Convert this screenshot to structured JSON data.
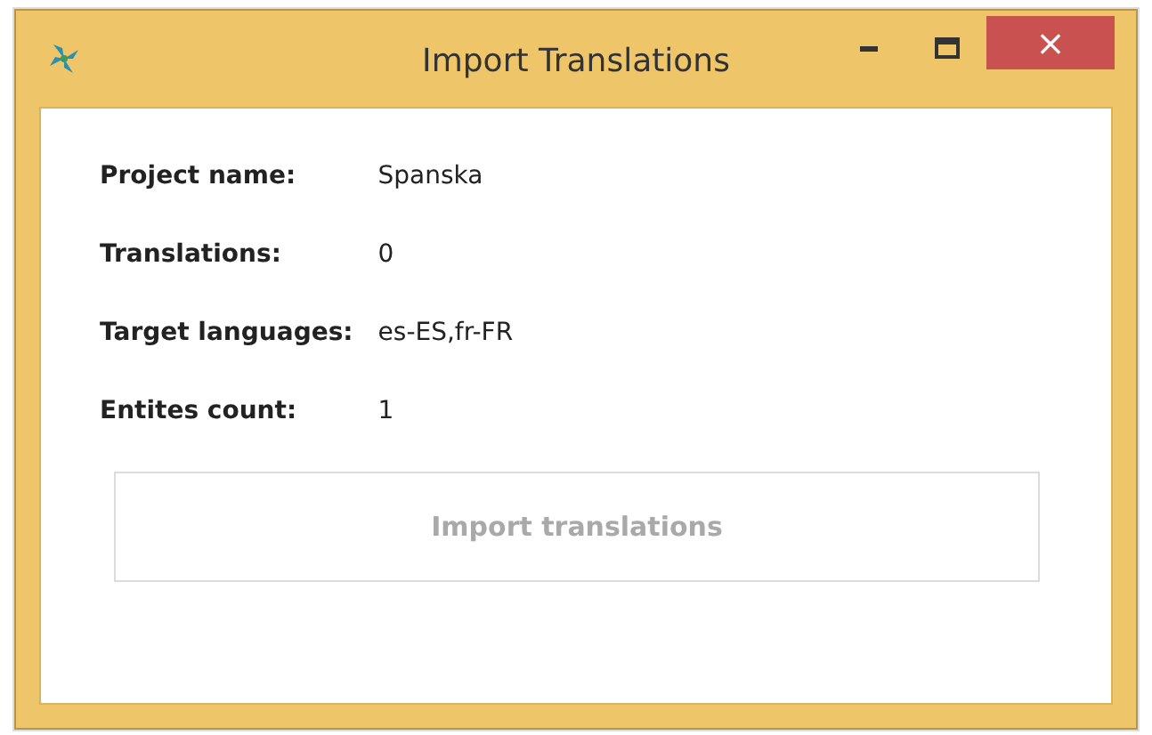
{
  "window": {
    "title": "Import Translations",
    "close_glyph": "×"
  },
  "fields": [
    {
      "label": "Project name:",
      "value": "Spanska"
    },
    {
      "label": "Translations:",
      "value": "0"
    },
    {
      "label": "Target languages:",
      "value": "es-ES,fr-FR"
    },
    {
      "label": "Entites count:",
      "value": "1"
    }
  ],
  "button": {
    "label": "Import translations",
    "disabled": true
  }
}
